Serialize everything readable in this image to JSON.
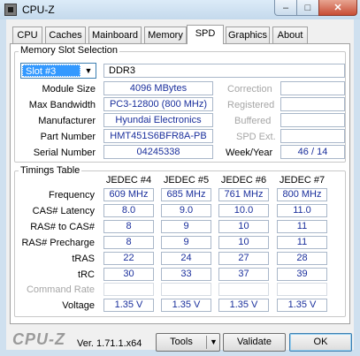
{
  "window": {
    "title": "CPU-Z",
    "minimize": "–",
    "maximize": "□",
    "close": "✕"
  },
  "tabs": [
    {
      "label": "CPU"
    },
    {
      "label": "Caches"
    },
    {
      "label": "Mainboard"
    },
    {
      "label": "Memory"
    },
    {
      "label": "SPD",
      "active": true
    },
    {
      "label": "Graphics"
    },
    {
      "label": "About"
    }
  ],
  "slot": {
    "group_title": "Memory Slot Selection",
    "selected": "Slot #3",
    "type": "DDR3",
    "rows": [
      {
        "label": "Module Size",
        "value": "4096 MBytes"
      },
      {
        "label": "Max Bandwidth",
        "value": "PC3-12800 (800 MHz)"
      },
      {
        "label": "Manufacturer",
        "value": "Hyundai Electronics"
      },
      {
        "label": "Part Number",
        "value": "HMT451S6BFR8A-PB"
      },
      {
        "label": "Serial Number",
        "value": "04245338"
      }
    ],
    "right_labels": {
      "correction": "Correction",
      "registered": "Registered",
      "buffered": "Buffered",
      "spd_ext": "SPD Ext.",
      "week_year": "Week/Year"
    },
    "week_year_value": "46 / 14"
  },
  "timings": {
    "group_title": "Timings Table",
    "headers": [
      "JEDEC #4",
      "JEDEC #5",
      "JEDEC #6",
      "JEDEC #7"
    ],
    "rows": [
      {
        "label": "Frequency",
        "values": [
          "609 MHz",
          "685 MHz",
          "761 MHz",
          "800 MHz"
        ]
      },
      {
        "label": "CAS# Latency",
        "values": [
          "8.0",
          "9.0",
          "10.0",
          "11.0"
        ]
      },
      {
        "label": "RAS# to CAS#",
        "values": [
          "8",
          "9",
          "10",
          "11"
        ]
      },
      {
        "label": "RAS# Precharge",
        "values": [
          "8",
          "9",
          "10",
          "11"
        ]
      },
      {
        "label": "tRAS",
        "values": [
          "22",
          "24",
          "27",
          "28"
        ]
      },
      {
        "label": "tRC",
        "values": [
          "30",
          "33",
          "37",
          "39"
        ]
      },
      {
        "label": "Command Rate",
        "values": [
          "",
          "",
          "",
          ""
        ],
        "disabled": true
      },
      {
        "label": "Voltage",
        "values": [
          "1.35 V",
          "1.35 V",
          "1.35 V",
          "1.35 V"
        ]
      }
    ]
  },
  "footer": {
    "brand": "CPU-Z",
    "version": "Ver. 1.71.1.x64",
    "tools_label": "Tools",
    "validate_label": "Validate",
    "ok_label": "OK"
  }
}
